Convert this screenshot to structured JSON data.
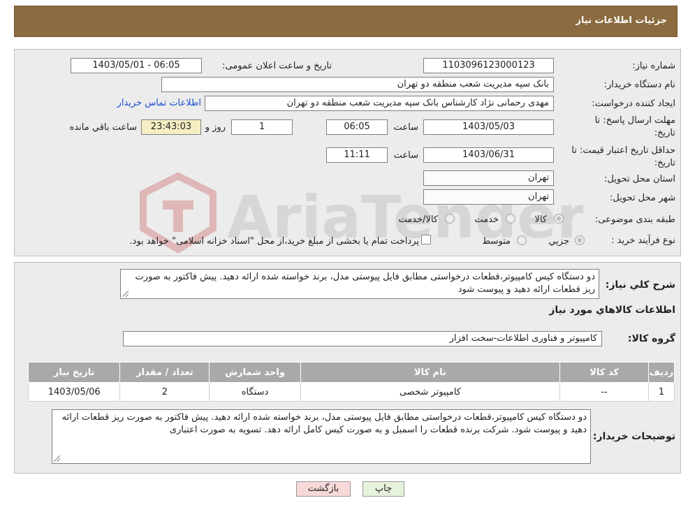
{
  "header": {
    "title": "جزئیات اطلاعات نیاز"
  },
  "form": {
    "need_number_label": "شماره نیاز:",
    "need_number": "1103096123000123",
    "announce_label": "تاریخ و ساعت اعلان عمومی:",
    "announce_value": "1403/05/01 - 06:05",
    "buyer_org_label": "نام دستگاه خریدار:",
    "buyer_org": "بانک سپه مدیریت شعب منطقه دو تهران",
    "creator_label": "ایجاد کننده درخواست:",
    "creator": "مهدی رحمانی نژاد کارشناس بانک سپه مدیریت شعب منطقه دو تهران",
    "contact_link": "اطلاعات تماس خریدار",
    "deadline_label_1": "مهلت ارسال پاسخ: تا",
    "deadline_label_2": "تاریخ:",
    "deadline_date": "1403/05/03",
    "hour_label": "ساعت",
    "deadline_time": "06:05",
    "days_value": "1",
    "days_label": "روز و",
    "remaining_time": "23:43:03",
    "remaining_label": "ساعت باقي مانده",
    "validity_label_1": "حداقل تاریخ اعتبار قیمت: تا",
    "validity_label_2": "تاریخ:",
    "validity_date": "1403/06/31",
    "validity_time": "11:11",
    "province_label": "استان محل تحویل:",
    "province": "تهران",
    "city_label": "شهر محل تحویل:",
    "city": "تهران",
    "category_label": "طبقه بندی موضوعی:",
    "category_options": [
      "کالا",
      "خدمت",
      "کالا/خدمت"
    ],
    "purchase_type_label": "نوع فرآیند خرید :",
    "purchase_options": [
      "جزیي",
      "متوسط"
    ],
    "purchase_note": "پرداخت تمام یا بخشی از مبلغ خرید،از محل \"اسناد خزانه اسلامی\" خواهد بود."
  },
  "details": {
    "summary_label": "شرح کلي نياز:",
    "summary_text": "دو دستگاه کیس کامپیوتر،قطعات درخواستی مطابق فایل پیوستی مدل، برند خواسته شده ارائه دهید. پیش فاکتور به صورت ریز قطعات ارائه دهید و پیوست شود",
    "goods_info_title": "اطلاعات کالاهاي مورد نياز",
    "goods_group_label": "گروه کالا:",
    "goods_group": "کامپیوتر و فناوری اطلاعات-سخت افزار",
    "table": {
      "headers": [
        "رديف",
        "کد کالا",
        "نام کالا",
        "واحد شمارش",
        "تعداد / مقدار",
        "تاریخ نیاز"
      ],
      "rows": [
        [
          "1",
          "--",
          "کامپیوتر شخصی",
          "دستگاه",
          "2",
          "1403/05/06"
        ]
      ]
    },
    "buyer_notes_label": "توضیحات خریدار:",
    "buyer_notes": "دو دستگاه کیس کامپیوتر،قطعات درخواستی مطابق فایل پیوستی مدل، برند خواسته شده ارائه دهید. پیش فاکتور به صورت ریز قطعات ارائه دهید و پیوست شود. شرکت برنده قطعات را اسمبل و به صورت کیس کامل ارائه دهد. تسویه به صورت اعتباری"
  },
  "buttons": {
    "print": "چاپ",
    "back": "بازگشت"
  },
  "watermark": {
    "text": "AriaTender.neT"
  },
  "colors": {
    "header": "#8b6b3f",
    "panel": "#ececec",
    "table_header": "#a9a9a9",
    "link": "#1a4fd0",
    "back_button": "#f7d9d9",
    "print_button": "#e6f2dc"
  }
}
